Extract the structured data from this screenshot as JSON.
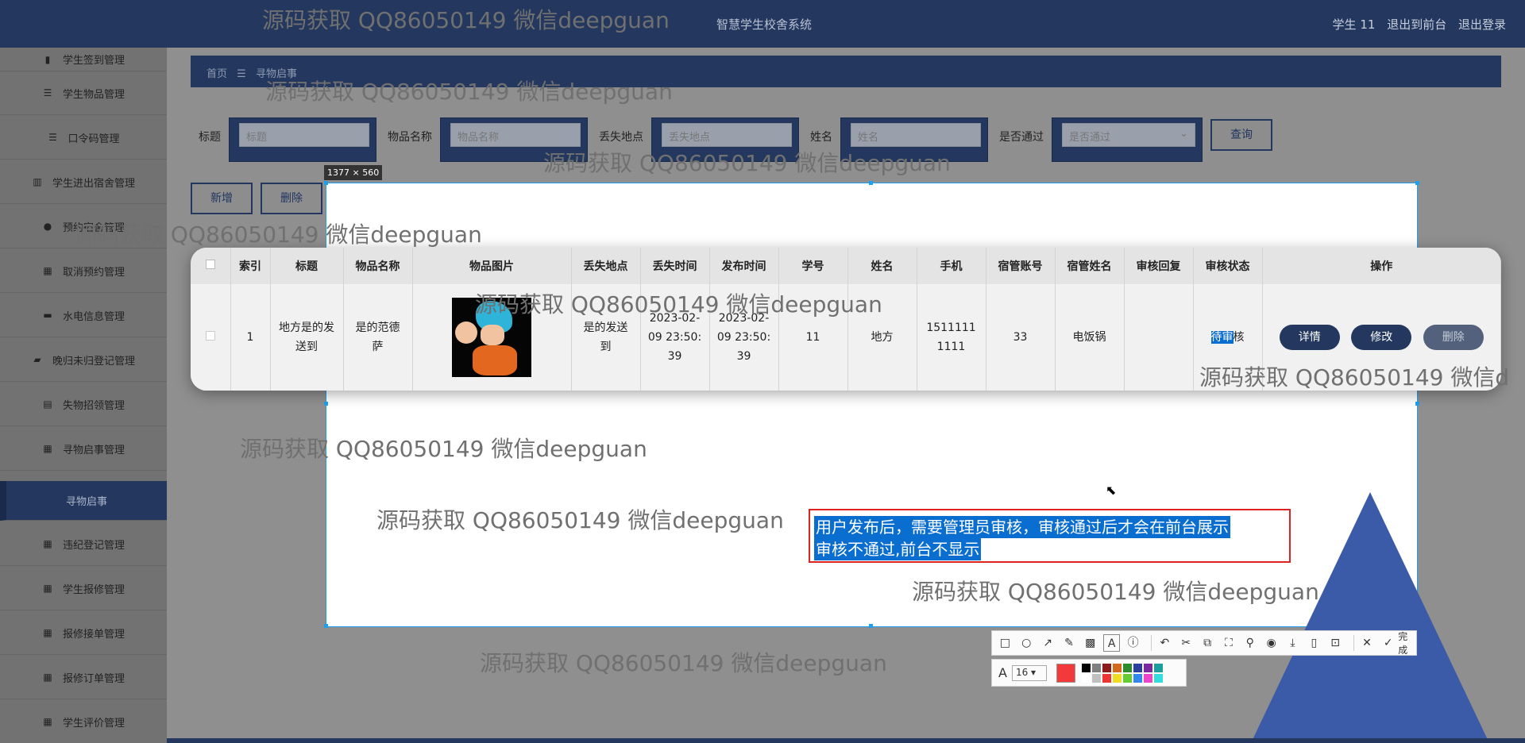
{
  "topbar": {
    "system_title": "智慧学生校舍系统",
    "user": "学生 11",
    "to_front": "退出到前台",
    "logout": "退出登录"
  },
  "sidebar": {
    "items": [
      {
        "label": "学生签到管理",
        "icon": "book-icon"
      },
      {
        "label": "学生物品管理",
        "icon": "list-icon"
      },
      {
        "label": "口令码管理",
        "icon": "list-icon"
      },
      {
        "label": "学生进出宿舍管理",
        "icon": "bar-chart-icon"
      },
      {
        "label": "预约宿舍管理",
        "icon": "user-icon"
      },
      {
        "label": "取消预约管理",
        "icon": "grid-icon"
      },
      {
        "label": "水电信息管理",
        "icon": "monitor-icon"
      },
      {
        "label": "晚归未归登记管理",
        "icon": "briefcase-icon"
      },
      {
        "label": "失物招领管理",
        "icon": "clipboard-icon"
      },
      {
        "label": "寻物启事管理",
        "icon": "grid-icon"
      },
      {
        "label": "寻物启事",
        "icon": ""
      },
      {
        "label": "违纪登记管理",
        "icon": "grid-icon"
      },
      {
        "label": "学生报修管理",
        "icon": "grid-icon"
      },
      {
        "label": "报修接单管理",
        "icon": "grid-icon"
      },
      {
        "label": "报修订单管理",
        "icon": "grid-icon"
      },
      {
        "label": "学生评价管理",
        "icon": "grid-icon"
      }
    ]
  },
  "breadcrumb": {
    "home": "首页",
    "sep": "☰",
    "current": "寻物启事"
  },
  "search": {
    "title_label": "标题",
    "title_placeholder": "标题",
    "item_label": "物品名称",
    "item_placeholder": "物品名称",
    "place_label": "丢失地点",
    "place_placeholder": "丢失地点",
    "name_label": "姓名",
    "name_placeholder": "姓名",
    "pass_label": "是否通过",
    "pass_placeholder": "是否通过",
    "query_button": "查询"
  },
  "actions": {
    "add": "新增",
    "delete": "删除"
  },
  "screenshot_tool": {
    "size_label": "1377 × 560",
    "done_label": "完成",
    "font_size": "16",
    "current_color": "#f23a3a",
    "swatches": [
      "#000000",
      "#808080",
      "#8b1a1a",
      "#d16a1a",
      "#2e8b2e",
      "#2b3f9e",
      "#7a2a9e",
      "#1a9e9e",
      "#ffffff",
      "#c0c0c0",
      "#ee3333",
      "#eedd22",
      "#66cc33",
      "#3388ee",
      "#ee44cc",
      "#33dddd"
    ]
  },
  "table": {
    "headers": [
      "",
      "索引",
      "标题",
      "物品名称",
      "物品图片",
      "丢失地点",
      "丢失时间",
      "发布时间",
      "学号",
      "姓名",
      "手机",
      "宿管账号",
      "宿管姓名",
      "审核回复",
      "审核状态",
      "操作"
    ],
    "row": {
      "index": "1",
      "title": "地方是的发送到",
      "item": "是的范德萨",
      "place": "是的发送到",
      "lost_time": "2023-02-09 23:50:39",
      "publish_time": "2023-02-09 23:50:39",
      "student_no": "11",
      "name": "地方",
      "phone": "15111111111",
      "manager_account": "33",
      "manager_name": "电饭锅",
      "reply": "",
      "status_selected": "待审",
      "status_rest": "核",
      "detail": "详情",
      "edit": "修改",
      "remove": "删除"
    }
  },
  "annotation": {
    "line1": "用户发布后，需要管理员审核，审核通过后才会在前台展示",
    "line2": "审核不通过,前台不显示"
  },
  "watermark": "源码获取 QQ86050149 微信deepguan",
  "watermark_partial": "源码获取 QQ86050149 微信d"
}
